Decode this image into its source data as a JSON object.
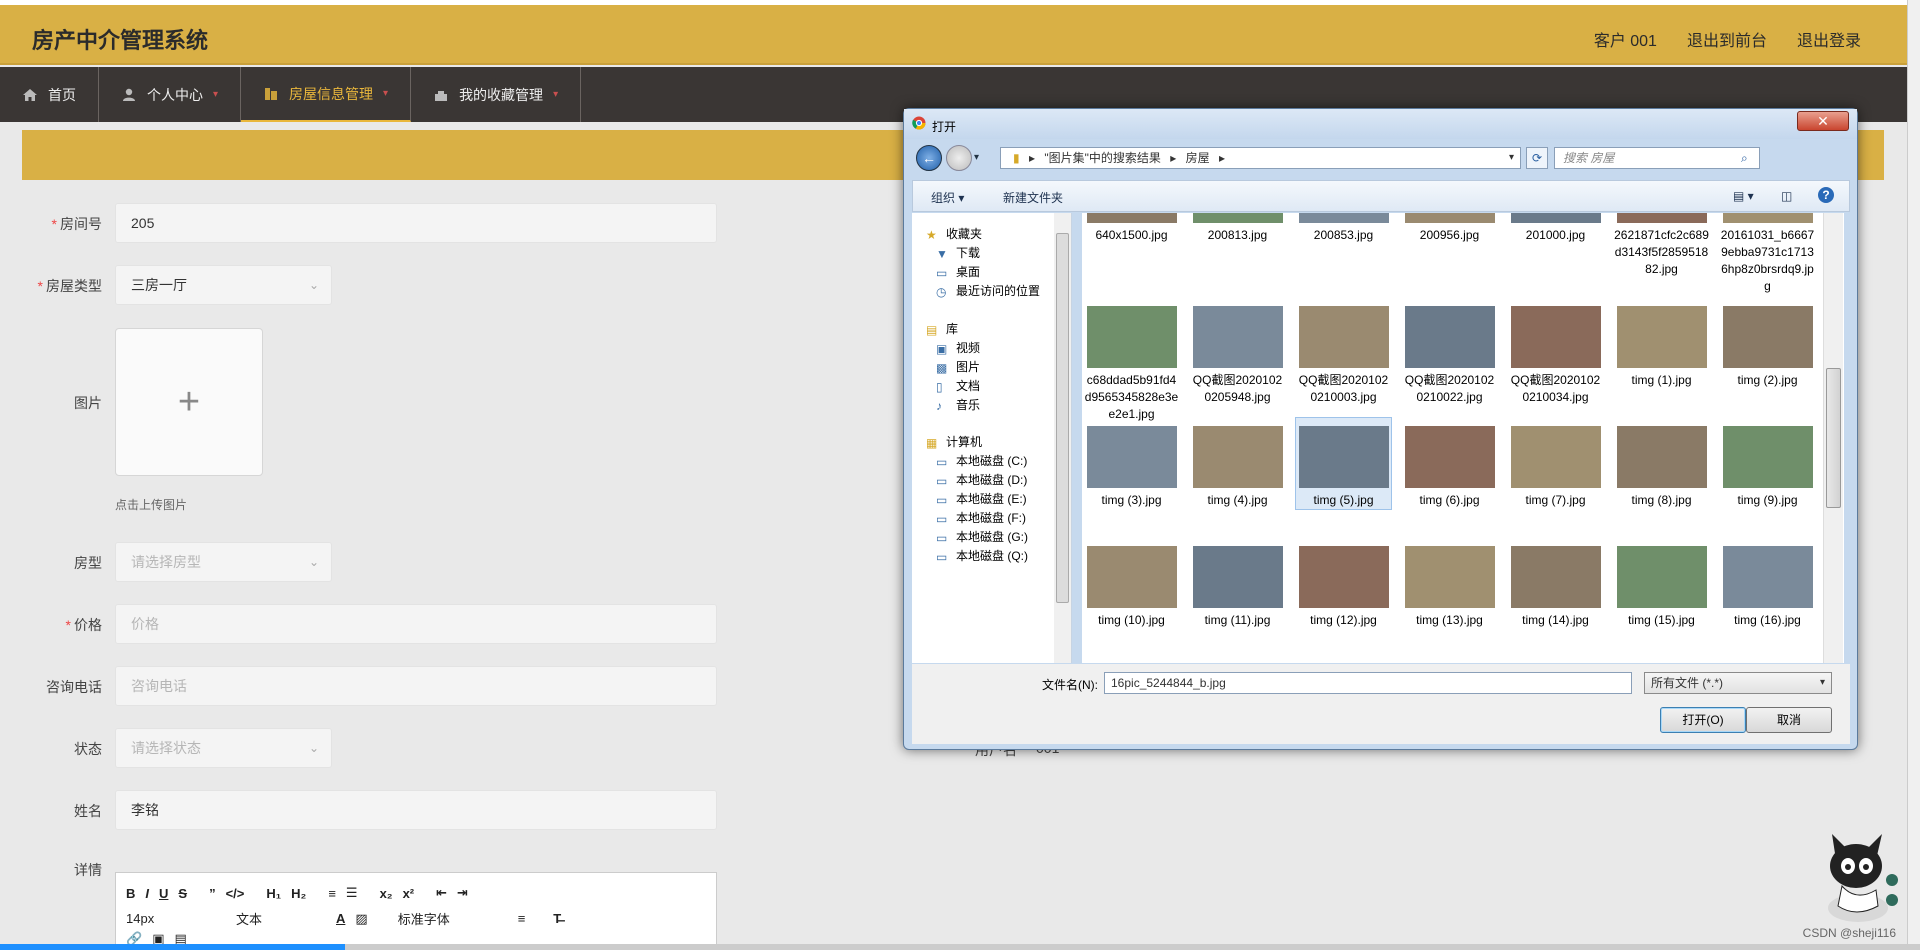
{
  "app": {
    "title": "房产中介管理系统"
  },
  "header_links": {
    "user": "客户 001",
    "front": "退出到前台",
    "logout": "退出登录"
  },
  "nav": [
    {
      "label": "首页",
      "icon": "home-icon",
      "caret": false
    },
    {
      "label": "个人中心",
      "icon": "user-icon",
      "caret": true
    },
    {
      "label": "房屋信息管理",
      "icon": "building-icon",
      "caret": true,
      "active": true
    },
    {
      "label": "我的收藏管理",
      "icon": "favorite-icon",
      "caret": true
    }
  ],
  "form": {
    "room_no": {
      "label": "房间号",
      "value": "205",
      "required": true
    },
    "room_type": {
      "label": "房屋类型",
      "value": "三房一厅",
      "required": true
    },
    "image": {
      "label": "图片",
      "hint": "点击上传图片"
    },
    "layout": {
      "label": "房型",
      "placeholder": "请选择房型"
    },
    "price": {
      "label": "价格",
      "placeholder": "价格",
      "required": true
    },
    "phone": {
      "label": "咨询电话",
      "placeholder": "咨询电话"
    },
    "status": {
      "label": "状态",
      "placeholder": "请选择状态"
    },
    "name": {
      "label": "姓名",
      "value": "李铭"
    },
    "detail": {
      "label": "详情"
    }
  },
  "editor": {
    "row1": [
      "B",
      "I",
      "U",
      "S",
      "”",
      "</>",
      "H₁",
      "H₂",
      "≡",
      "☰",
      "x₂",
      "x²",
      "⇤",
      "⇥"
    ],
    "row2": {
      "size": "14px",
      "style": "文本",
      "font": "标准字体"
    }
  },
  "behind_dialog_text": {
    "label": "用户名",
    "value": "001"
  },
  "dialog": {
    "title": "打开",
    "path_items": [
      "\"图片集\"中的搜索结果",
      "房屋"
    ],
    "search_placeholder": "搜索 房屋",
    "toolbar": {
      "organize": "组织",
      "new_folder": "新建文件夹"
    },
    "sidebar": [
      {
        "label": "收藏夹",
        "group": true
      },
      {
        "label": "下载"
      },
      {
        "label": "桌面"
      },
      {
        "label": "最近访问的位置"
      },
      {
        "label": "库",
        "group": true
      },
      {
        "label": "视频"
      },
      {
        "label": "图片"
      },
      {
        "label": "文档"
      },
      {
        "label": "音乐"
      },
      {
        "label": "计算机",
        "group": true
      },
      {
        "label": "本地磁盘 (C:)"
      },
      {
        "label": "本地磁盘 (D:)"
      },
      {
        "label": "本地磁盘 (E:)"
      },
      {
        "label": "本地磁盘 (F:)"
      },
      {
        "label": "本地磁盘 (G:)"
      },
      {
        "label": "本地磁盘 (Q:)"
      }
    ],
    "files_row0": [
      "640x1500.jpg",
      "200813.jpg",
      "200853.jpg",
      "200956.jpg",
      "201000.jpg",
      "2621871cfc2c689d3143f5f285951882.jpg",
      "20161031_b66679ebba9731c17136hp8z0brsrdq9.jpg"
    ],
    "files_row1": [
      "c68ddad5b91fd4d9565345828e3ee2e1.jpg",
      "QQ截图20201020205948.jpg",
      "QQ截图20201020210003.jpg",
      "QQ截图20201020210022.jpg",
      "QQ截图20201020210034.jpg",
      "timg (1).jpg",
      "timg (2).jpg"
    ],
    "files_row2": [
      "timg (3).jpg",
      "timg (4).jpg",
      "timg (5).jpg",
      "timg (6).jpg",
      "timg (7).jpg",
      "timg (8).jpg",
      "timg (9).jpg"
    ],
    "files_row3": [
      "timg (10).jpg",
      "timg (11).jpg",
      "timg (12).jpg",
      "timg (13).jpg",
      "timg (14).jpg",
      "timg (15).jpg",
      "timg (16).jpg"
    ],
    "filename_label": "文件名(N):",
    "filename_value": "16pic_5244844_b.jpg",
    "filetype": "所有文件 (*.*)",
    "open_button": "打开(O)",
    "cancel_button": "取消"
  },
  "watermark": "CSDN @sheji116",
  "colors": {
    "header": "#d9b045",
    "nav": "#3a3634",
    "nav_active": "#e9b73c"
  }
}
